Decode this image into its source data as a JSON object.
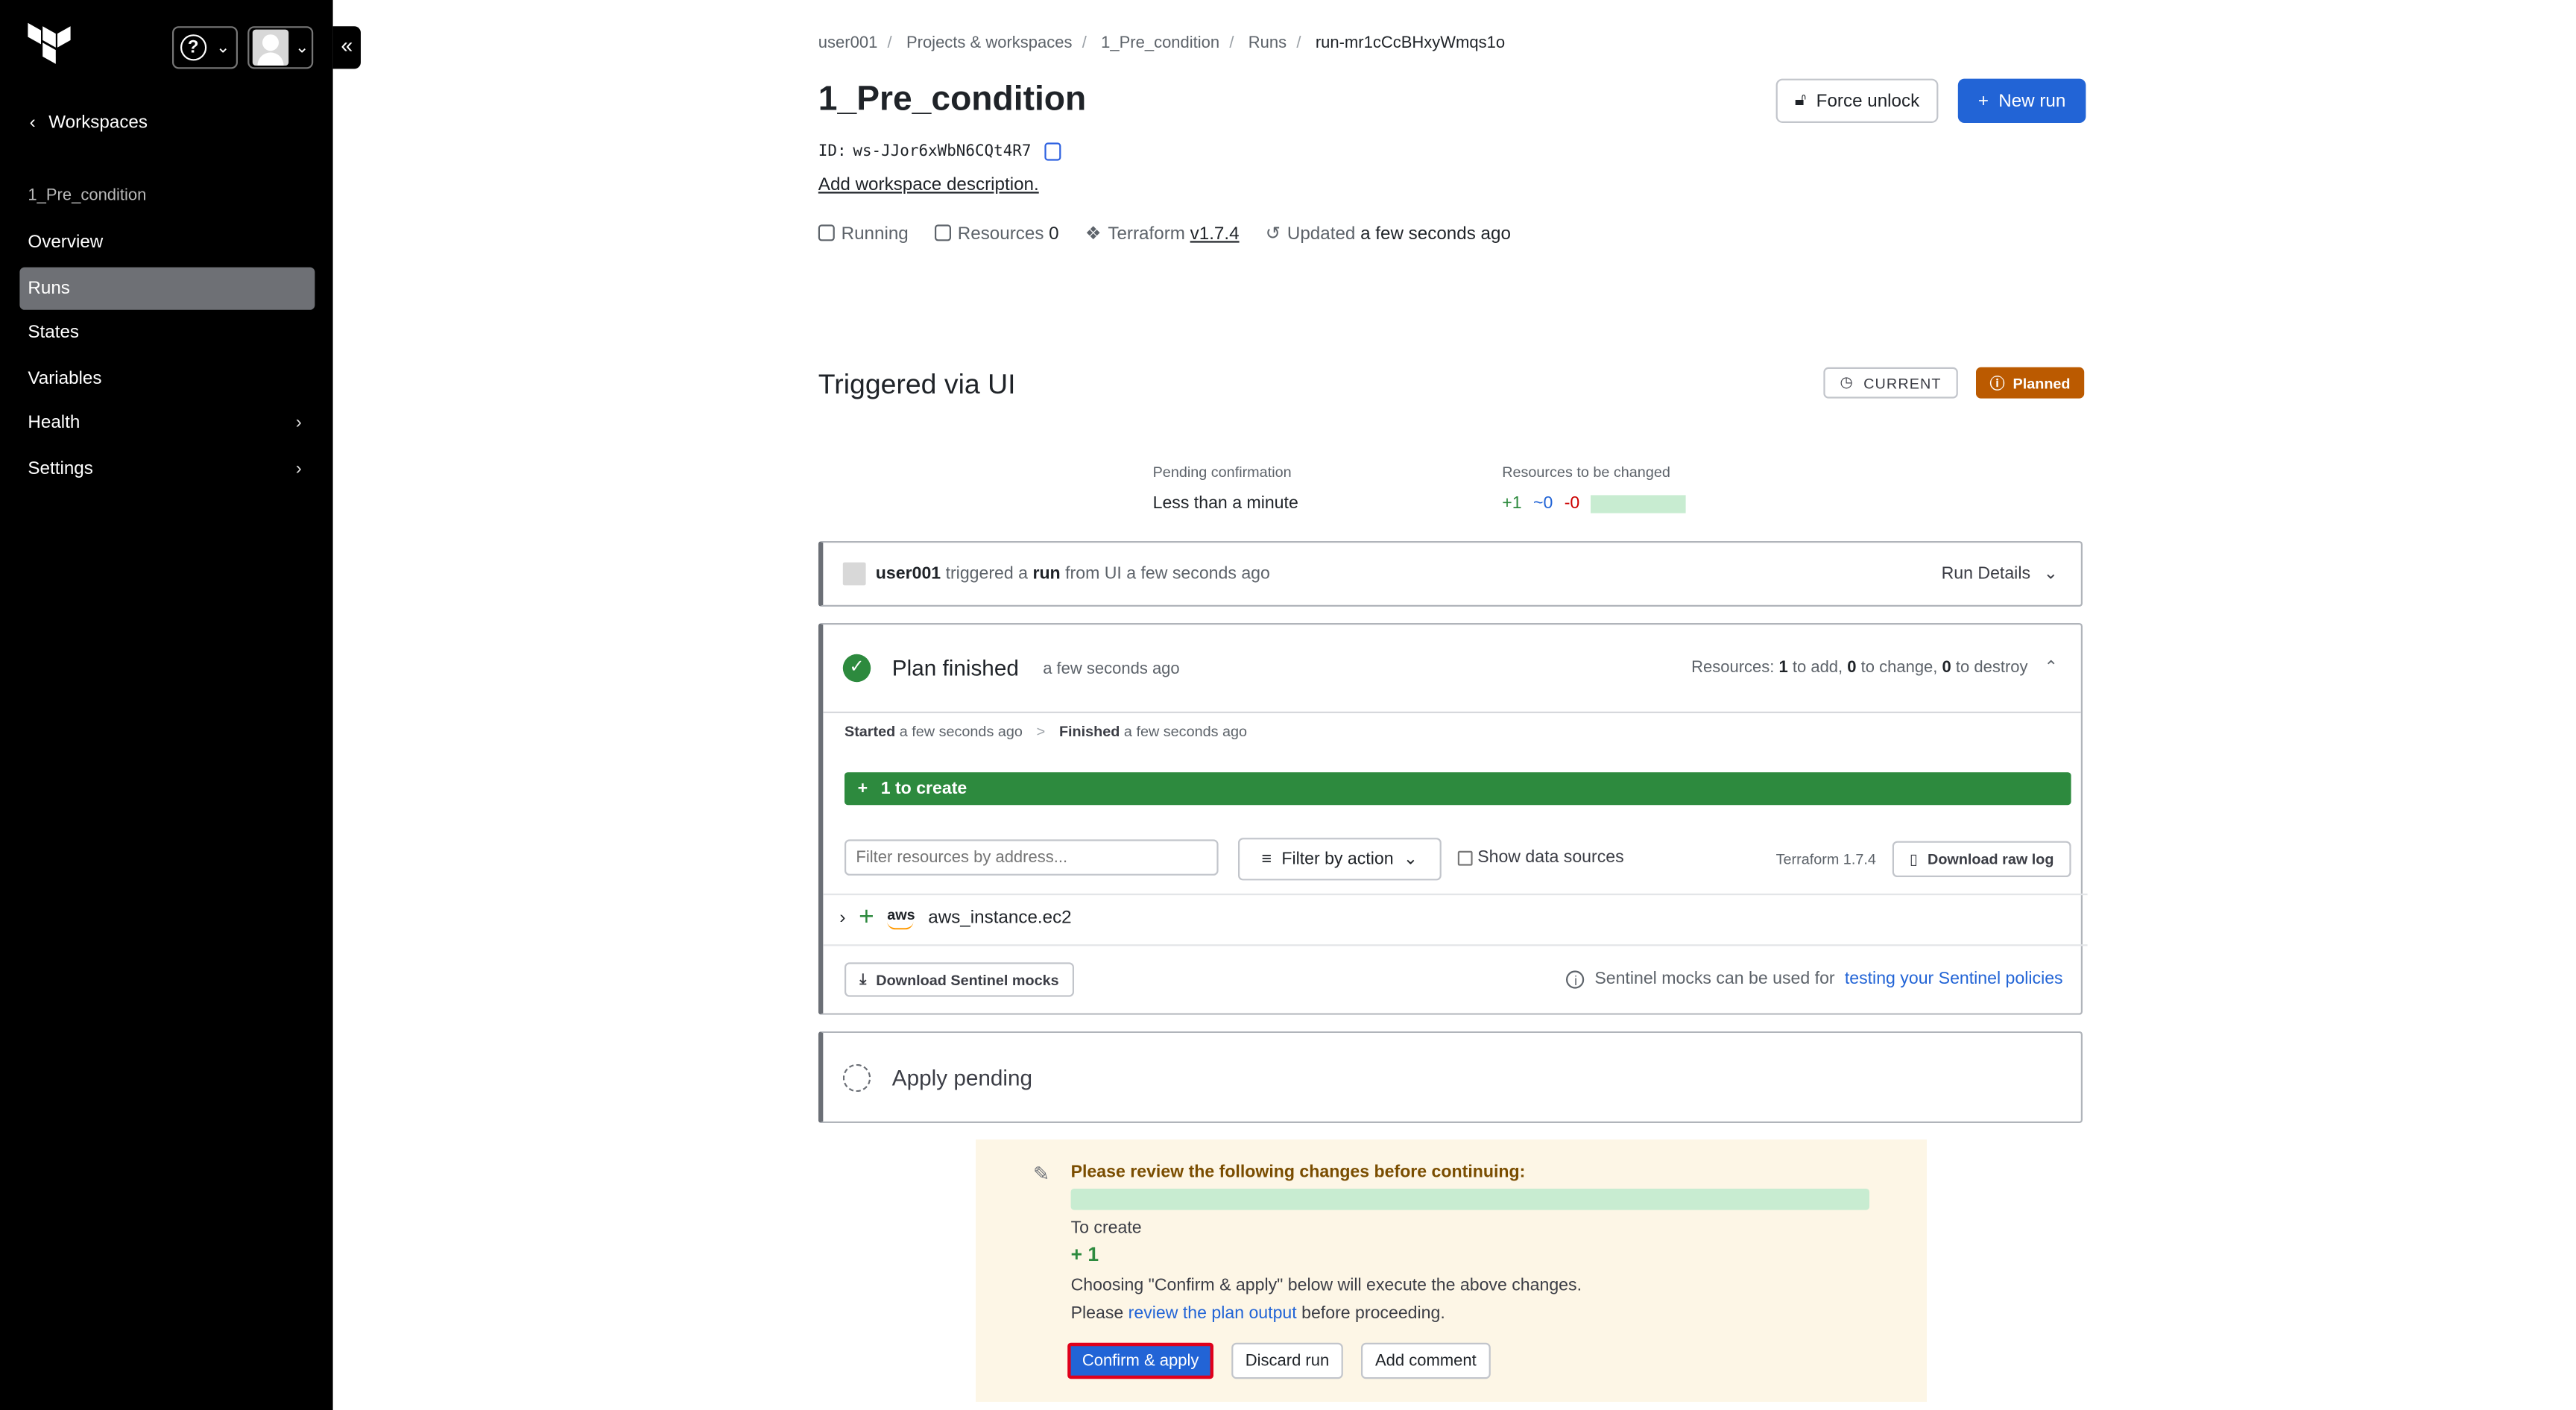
{
  "sidebar": {
    "back_label": "Workspaces",
    "workspace_name": "1_Pre_condition",
    "items": [
      {
        "label": "Overview",
        "active": false,
        "has_submenu": false
      },
      {
        "label": "Runs",
        "active": true,
        "has_submenu": false
      },
      {
        "label": "States",
        "active": false,
        "has_submenu": false
      },
      {
        "label": "Variables",
        "active": false,
        "has_submenu": false
      },
      {
        "label": "Health",
        "active": false,
        "has_submenu": true
      },
      {
        "label": "Settings",
        "active": false,
        "has_submenu": true
      }
    ]
  },
  "breadcrumb": [
    "user001",
    "Projects & workspaces",
    "1_Pre_condition",
    "Runs",
    "run-mr1cCcBHxyWmqs1o"
  ],
  "workspace": {
    "title": "1_Pre_condition",
    "id_label": "ID:",
    "id_value": "ws-JJor6xWbN6CQt4R7",
    "add_description": "Add workspace description.",
    "status": "Running",
    "resources_label": "Resources",
    "resources_count": "0",
    "terraform_label": "Terraform",
    "terraform_version": "v1.7.4",
    "updated_label": "Updated",
    "updated_value": "a few seconds ago"
  },
  "actions": {
    "force_unlock": "Force unlock",
    "new_run": "New run"
  },
  "run": {
    "title": "Triggered via UI",
    "current_tag": "CURRENT",
    "status_tag": "Planned",
    "pending_label": "Pending confirmation",
    "pending_value": "Less than a minute",
    "resources_changed_label": "Resources to be changed",
    "add": "+1",
    "change": "~0",
    "destroy": "-0"
  },
  "trigger": {
    "user": "user001",
    "text1": "triggered a",
    "run_word": "run",
    "text2": "from UI a few seconds ago",
    "details": "Run Details"
  },
  "plan": {
    "title": "Plan finished",
    "time": "a few seconds ago",
    "resources_prefix": "Resources:",
    "to_add": "1",
    "to_add_label": "to add,",
    "to_change": "0",
    "to_change_label": "to change,",
    "to_destroy": "0",
    "to_destroy_label": "to destroy",
    "started_label": "Started",
    "started_value": "a few seconds ago",
    "finished_label": "Finished",
    "finished_value": "a few seconds ago",
    "create_bar": "1 to create",
    "filter_placeholder": "Filter resources by address...",
    "filter_by_action": "Filter by action",
    "show_data_sources": "Show data sources",
    "terraform_version": "Terraform 1.7.4",
    "download_raw_log": "Download raw log",
    "resource_name": "aws_instance.ec2",
    "provider_logo": "aws",
    "download_mocks": "Download Sentinel mocks",
    "mocks_text": "Sentinel mocks can be used for",
    "mocks_link": "testing your Sentinel policies"
  },
  "apply": {
    "title": "Apply pending"
  },
  "review": {
    "heading": "Please review the following changes before continuing:",
    "to_create_label": "To create",
    "to_create_value": "+ 1",
    "para1": "Choosing \"Confirm & apply\" below will execute the above changes.",
    "para2_pre": "Please",
    "para2_link": "review the plan output",
    "para2_post": "before proceeding.",
    "confirm": "Confirm & apply",
    "discard": "Discard run",
    "comment": "Add comment"
  }
}
